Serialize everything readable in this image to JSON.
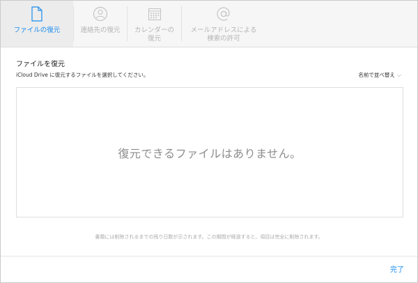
{
  "tabs": [
    {
      "label": "ファイルの復元",
      "icon": "document-icon",
      "active": true
    },
    {
      "label": "連絡先の復元",
      "icon": "contacts-icon",
      "active": false
    },
    {
      "label": "カレンダーの\n復元",
      "icon": "calendar-icon",
      "active": false
    },
    {
      "label": "メールアドレスによる\n検索の許可",
      "icon": "at-sign-icon",
      "active": false
    }
  ],
  "main": {
    "title": "ファイルを復元",
    "description": "iCloud Drive に復元するファイルを選択してください。",
    "sort_label": "名前で並べ替え",
    "empty_message": "復元できるファイルはありません。",
    "footnote": "書類には削除されるまでの残り日数が示されます。この期間が経過すると、項目は完全に削除されます。"
  },
  "footer": {
    "done_label": "完了"
  },
  "colors": {
    "accent": "#1a8cf0",
    "inactive": "#b5b5b5",
    "toolbar_bg": "#f6f6f6"
  }
}
